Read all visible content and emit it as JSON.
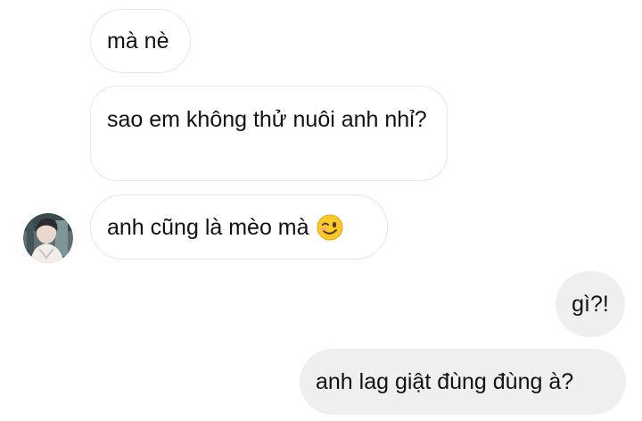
{
  "messages": [
    {
      "sender": "other",
      "text": "mà nè"
    },
    {
      "sender": "other",
      "text": "sao em không thử nuôi anh nhỉ?"
    },
    {
      "sender": "other",
      "text": "anh cũng là mèo mà",
      "emoji": "winking-face-emoji"
    },
    {
      "sender": "me",
      "text": "gì?!"
    },
    {
      "sender": "me",
      "text": "anh lag giật đùng đùng à?"
    }
  ],
  "colors": {
    "incoming_bubble_bg": "#ffffff",
    "incoming_bubble_border": "#e6e6e6",
    "outgoing_bubble_bg": "#efefef",
    "text": "#111111"
  },
  "avatar": {
    "icon": "profile-photo"
  }
}
